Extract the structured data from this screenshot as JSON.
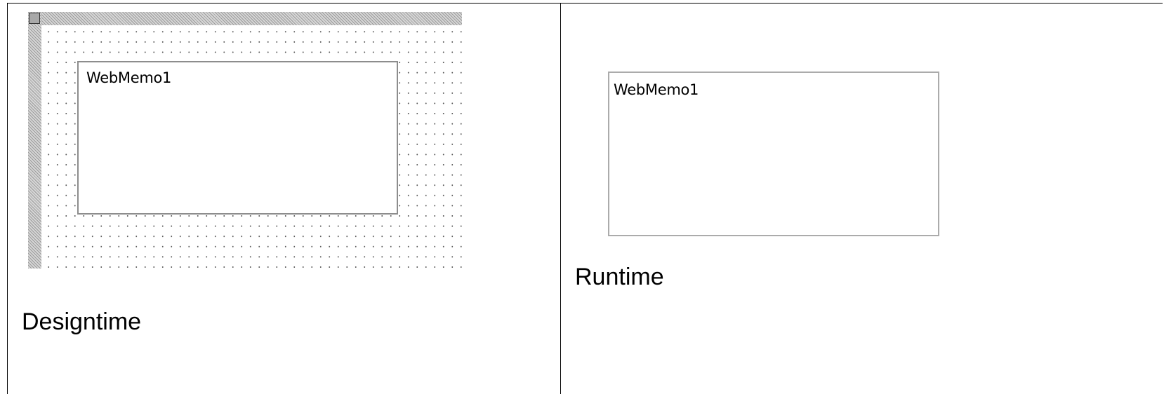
{
  "designtime": {
    "memo_text": "WebMemo1",
    "caption": "Designtime"
  },
  "runtime": {
    "memo_text": "WebMemo1",
    "caption": "Runtime"
  },
  "icons": {
    "grip": "resize-grip-icon"
  },
  "colors": {
    "border": "#000000",
    "memo_border_design": "#8d8d8d",
    "memo_border_runtime": "#ababab",
    "hatch": "#9c9c9c",
    "grid_dot": "#555555"
  }
}
